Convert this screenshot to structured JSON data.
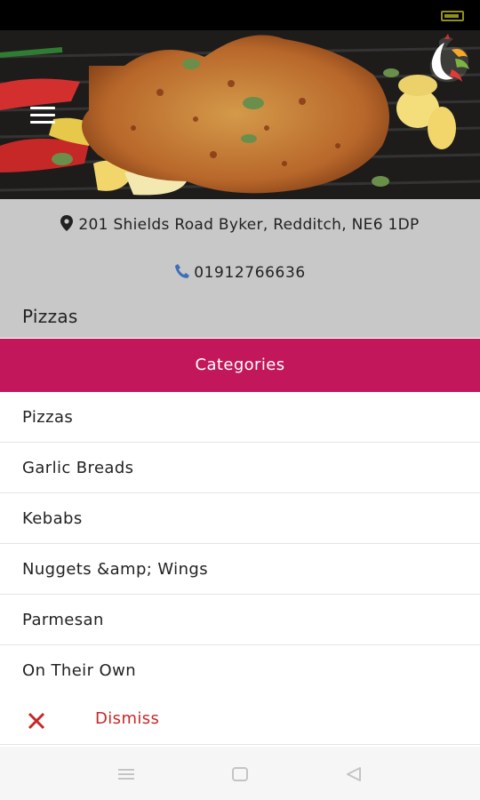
{
  "restaurant": {
    "address": "201 Shields Road Byker, Redditch, NE6 1DP",
    "phone": "01912766636",
    "current_category": "Pizzas"
  },
  "categories_panel": {
    "title": "Categories",
    "items": [
      {
        "label": "Pizzas"
      },
      {
        "label": "Garlic Breads"
      },
      {
        "label": "Kebabs"
      },
      {
        "label": "Nuggets &amp; Wings"
      },
      {
        "label": "Parmesan"
      },
      {
        "label": "On Their Own"
      }
    ],
    "dismiss_label": "Dismiss"
  },
  "colors": {
    "accent": "#c2185b",
    "dismiss": "#c62828",
    "info_bg": "#c8c8c8",
    "phone_icon": "#3f6fb5"
  },
  "icons": [
    "menu-icon",
    "logo-icon",
    "location-pin-icon",
    "phone-icon",
    "close-icon",
    "nav-menu-icon",
    "nav-home-icon",
    "nav-back-icon"
  ]
}
